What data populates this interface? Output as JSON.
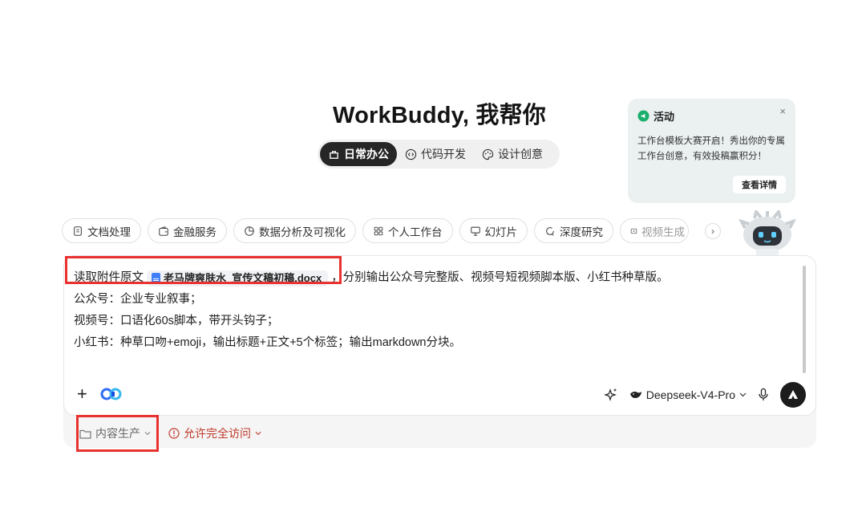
{
  "header": {
    "title": "WorkBuddy, 我帮你"
  },
  "mode_tabs": [
    {
      "label": "日常办公",
      "icon": "office-icon",
      "active": true
    },
    {
      "label": "代码开发",
      "icon": "code-icon",
      "active": false
    },
    {
      "label": "设计创意",
      "icon": "palette-icon",
      "active": false
    }
  ],
  "promo": {
    "tag": "活动",
    "close": "×",
    "text": "工作台模板大赛开启！秀出你的专属工作台创意，有效投稿赢积分！",
    "button": "查看详情"
  },
  "chips": [
    {
      "label": "文档处理",
      "icon": "document-icon"
    },
    {
      "label": "金融服务",
      "icon": "wallet-icon"
    },
    {
      "label": "数据分析及可视化",
      "icon": "pie-chart-icon"
    },
    {
      "label": "个人工作台",
      "icon": "grid-icon"
    },
    {
      "label": "幻灯片",
      "icon": "presentation-icon"
    },
    {
      "label": "深度研究",
      "icon": "research-icon"
    },
    {
      "label": "视频生成",
      "icon": "video-icon"
    }
  ],
  "composer": {
    "line1_prefix": "读取附件原文",
    "attachment": "老马牌爽肤水_宣传文稿初稿.docx",
    "line1_suffix": "，分别输出公众号完整版、视频号短视频脚本版、小红书种草版。",
    "line2": "公众号：企业专业叙事；",
    "line3": "视频号：口语化60s脚本，带开头钩子；",
    "line4": "小红书：种草口吻+emoji，输出标题+正文+5个标签；输出markdown分块。",
    "model": "Deepseek-V4-Pro",
    "add_icon": "+"
  },
  "footer": {
    "project": "内容生产",
    "access": "允许完全访问"
  },
  "colors": {
    "accent": "#1c1c1c",
    "highlight": "#e8322f",
    "warning": "#c0392b",
    "promo_bg": "#ebf0f0"
  }
}
